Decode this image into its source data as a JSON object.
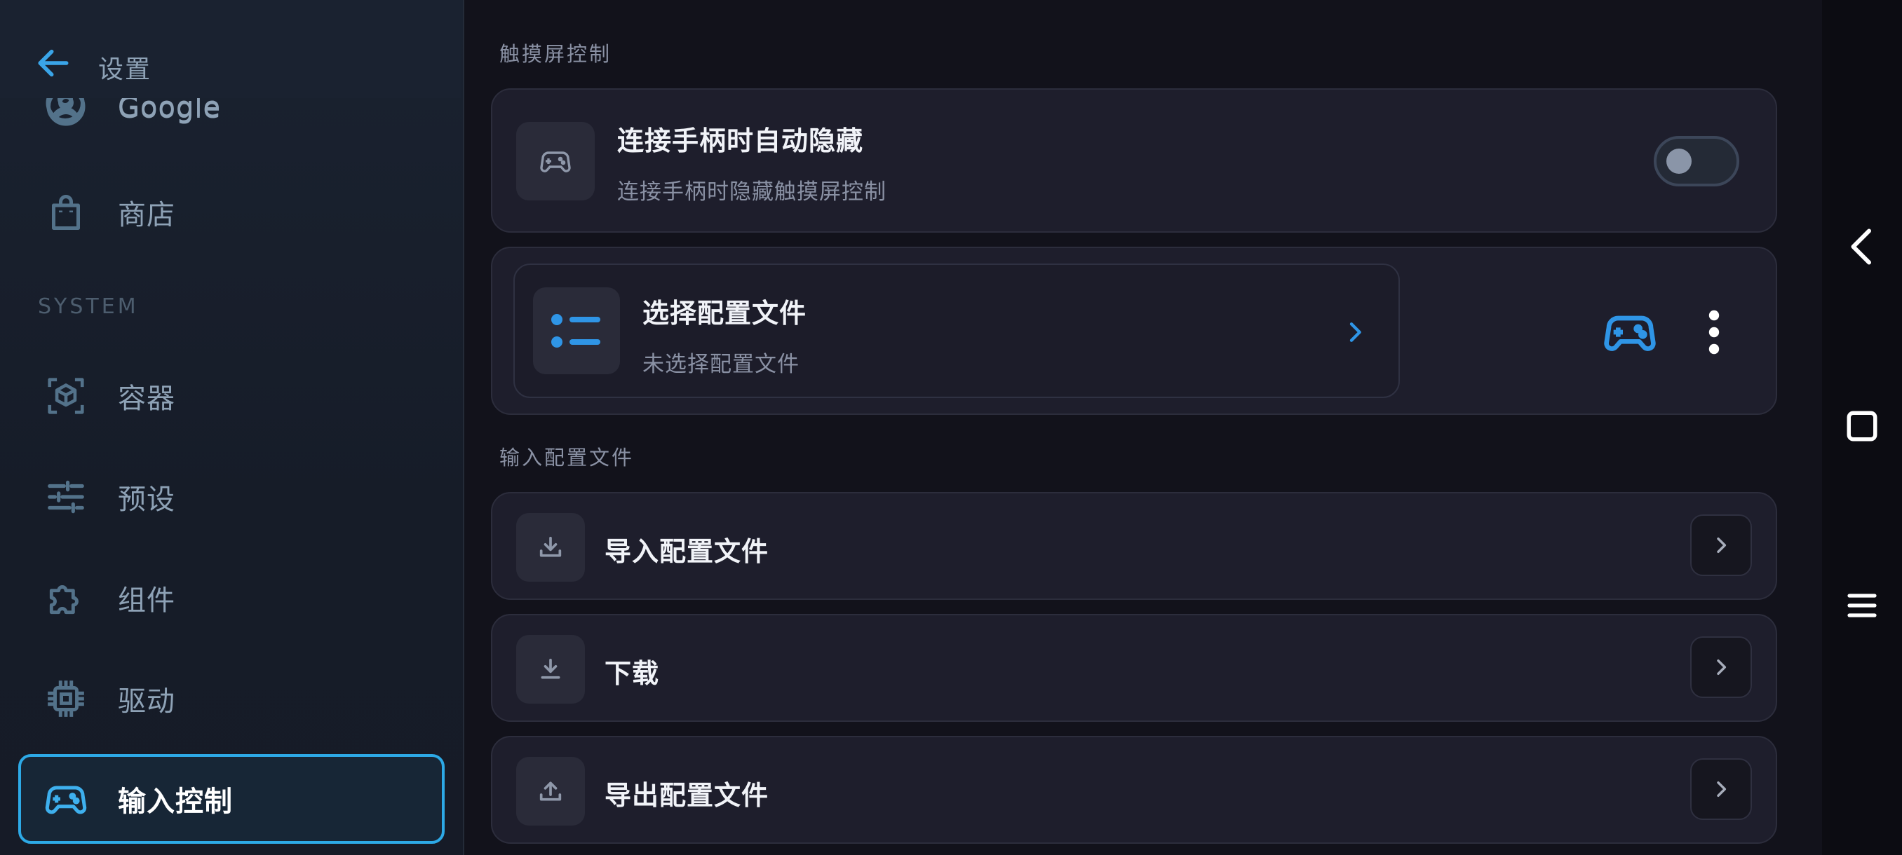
{
  "header": {
    "title": "设置"
  },
  "sidebar": {
    "items": [
      {
        "label": "Google",
        "icon": "account-circle-icon"
      },
      {
        "label": "商店",
        "icon": "shopping-bag-icon"
      }
    ],
    "system_header": "SYSTEM",
    "system_items": [
      {
        "label": "容器",
        "icon": "cube-icon"
      },
      {
        "label": "预设",
        "icon": "tune-sliders-icon"
      },
      {
        "label": "组件",
        "icon": "puzzle-icon"
      },
      {
        "label": "驱动",
        "icon": "chip-icon"
      },
      {
        "label": "输入控制",
        "icon": "gamepad-icon",
        "active": true
      }
    ]
  },
  "main": {
    "touch_section": {
      "label": "触摸屏控制",
      "auto_hide": {
        "title": "连接手柄时自动隐藏",
        "subtitle": "连接手柄时隐藏触摸屏控制",
        "enabled": false
      },
      "profile": {
        "title": "选择配置文件",
        "subtitle": "未选择配置文件"
      }
    },
    "input_section": {
      "label": "输入配置文件",
      "rows": [
        {
          "title": "导入配置文件",
          "icon": "download-icon"
        },
        {
          "title": "下载",
          "icon": "download-tray-icon"
        },
        {
          "title": "导出配置文件",
          "icon": "upload-icon"
        }
      ]
    }
  },
  "colors": {
    "accent": "#2da9e6",
    "profile_icon": "#2f95e6",
    "background": "#12121b",
    "card": "#1e1e2c"
  }
}
